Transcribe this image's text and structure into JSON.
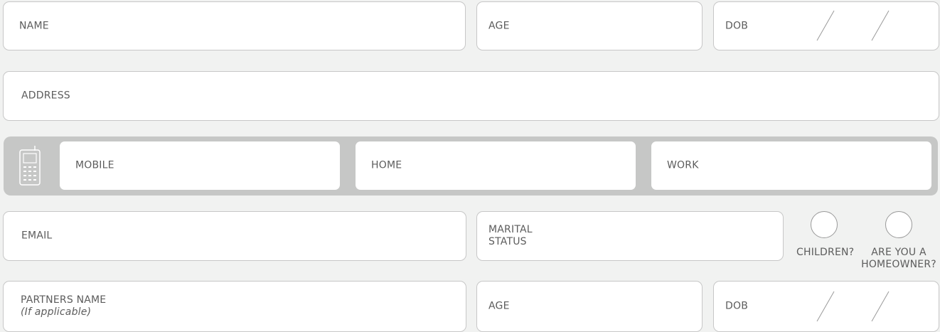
{
  "form": {
    "row1": {
      "name_label": "NAME",
      "age_label": "AGE",
      "dob_label": "DOB"
    },
    "row2": {
      "address_label": "ADDRESS"
    },
    "phone": {
      "icon": "mobile-phone-icon",
      "mobile_label": "MOBILE",
      "home_label": "HOME",
      "work_label": "WORK"
    },
    "row4": {
      "email_label": "EMAIL",
      "marital_line1": "MARITAL",
      "marital_line2": "STATUS",
      "children_label": "CHILDREN?",
      "homeowner_line1": "ARE YOU A",
      "homeowner_line2": "HOMEOWNER?"
    },
    "row5": {
      "partner_line1": "PARTNERS NAME",
      "partner_line2": "(If applicable)",
      "age_label": "AGE",
      "dob_label": "DOB"
    }
  },
  "colors": {
    "background": "#f1f2f1",
    "field_border": "#c7c7c7",
    "phone_band": "#c6c7c6",
    "text": "#5c5c5c"
  }
}
